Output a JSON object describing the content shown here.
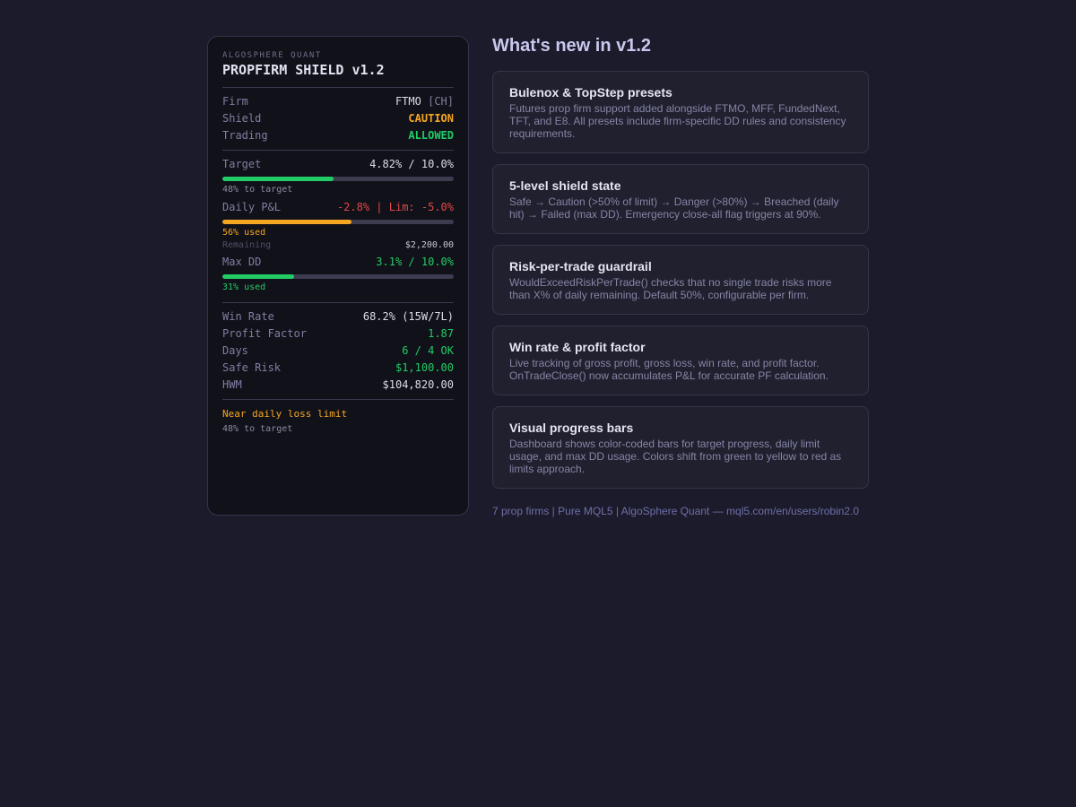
{
  "dashboard": {
    "brand": "ALGOSPHERE QUANT",
    "title": "PROPFIRM SHIELD v1.2",
    "firm_label": "Firm",
    "firm_value": "FTMO",
    "firm_region": "[CH]",
    "shield_label": "Shield",
    "shield_value": "CAUTION",
    "trading_label": "Trading",
    "trading_value": "ALLOWED",
    "target_label": "Target",
    "target_value": "4.82% / 10.0%",
    "target_progress": 0.48,
    "target_note": "48% to target",
    "daily_label": "Daily P&L",
    "daily_value": "-2.8% | Lim: -5.0%",
    "daily_progress": 0.56,
    "daily_note": "56% used",
    "remaining_label": "Remaining",
    "remaining_value": "$2,200.00",
    "maxdd_label": "Max DD",
    "maxdd_value": "3.1% / 10.0%",
    "maxdd_progress": 0.31,
    "maxdd_note": "31% used",
    "winrate_label": "Win Rate",
    "winrate_value": "68.2% (15W/7L)",
    "pf_label": "Profit Factor",
    "pf_value": "1.87",
    "days_label": "Days",
    "days_value": "6 / 4 OK",
    "saferisk_label": "Safe Risk",
    "saferisk_value": "$1,100.00",
    "hwm_label": "HWM",
    "hwm_value": "$104,820.00",
    "alert_text": "Near daily loss limit",
    "alert_note": "48% to target",
    "colors": {
      "green": "#22cc66",
      "amber": "#f5a623",
      "red": "#e04848"
    }
  },
  "whats_new": {
    "heading": "What's new in v1.2",
    "cards": [
      {
        "title": "Bulenox & TopStep presets",
        "desc": "Futures prop firm support added alongside FTMO, MFF, FundedNext, TFT, and E8. All presets include firm-specific DD rules and consistency requirements."
      },
      {
        "title": "5-level shield state",
        "desc": "Safe → Caution (>50% of limit) → Danger (>80%) → Breached (daily hit) → Failed (max DD). Emergency close-all flag triggers at 90%."
      },
      {
        "title": "Risk-per-trade guardrail",
        "desc": "WouldExceedRiskPerTrade() checks that no single trade risks more than X% of daily remaining. Default 50%, configurable per firm."
      },
      {
        "title": "Win rate & profit factor",
        "desc": "Live tracking of gross profit, gross loss, win rate, and profit factor. OnTradeClose() now accumulates P&L for accurate PF calculation."
      },
      {
        "title": "Visual progress bars",
        "desc": "Dashboard shows color-coded bars for target progress, daily limit usage, and max DD usage. Colors shift from green to yellow to red as limits approach."
      }
    ],
    "footer": "7 prop firms | Pure MQL5 | AlgoSphere Quant — mql5.com/en/users/robin2.0"
  }
}
